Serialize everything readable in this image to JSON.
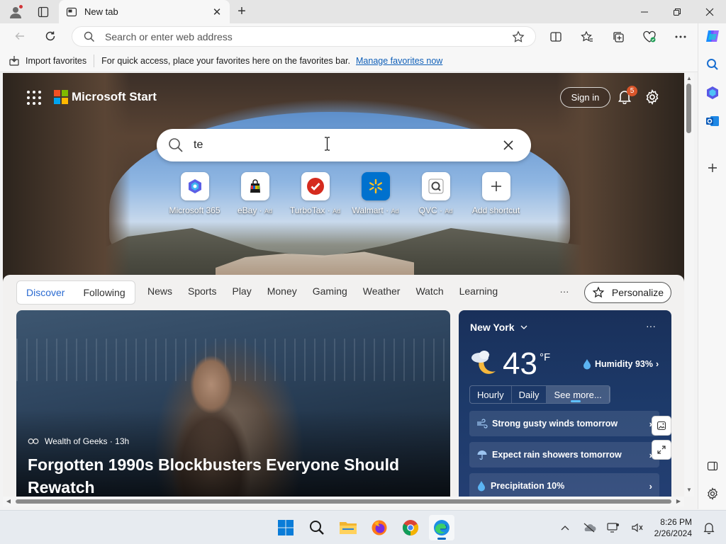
{
  "browser": {
    "tab_title": "New tab",
    "address_placeholder": "Search or enter web address"
  },
  "favorites_bar": {
    "import_label": "Import favorites",
    "hint_text": "For quick access, place your favorites here on the favorites bar.",
    "manage_link": "Manage favorites now"
  },
  "start": {
    "brand": "Microsoft Start",
    "sign_in": "Sign in",
    "notification_count": "5",
    "search_value": "te",
    "shortcuts": [
      {
        "label": "Microsoft 365",
        "ad": "",
        "icon": "microsoft-365-icon"
      },
      {
        "label": "eBay",
        "ad": "Ad",
        "icon": "ebay-icon"
      },
      {
        "label": "TurboTax",
        "ad": "Ad",
        "icon": "turbotax-icon"
      },
      {
        "label": "Walmart",
        "ad": "Ad",
        "icon": "walmart-icon"
      },
      {
        "label": "QVC",
        "ad": "Ad",
        "icon": "qvc-icon"
      },
      {
        "label": "Add shortcut",
        "ad": "",
        "icon": "plus-icon"
      }
    ]
  },
  "feed": {
    "primary_tabs": [
      "Discover",
      "Following"
    ],
    "active_tab": "Discover",
    "categories": [
      "News",
      "Sports",
      "Play",
      "Money",
      "Gaming",
      "Weather",
      "Watch",
      "Learning"
    ],
    "more": "···",
    "personalize": "Personalize"
  },
  "article": {
    "source": "Wealth of Geeks · 13h",
    "title": "Forgotten 1990s Blockbusters Everyone Should Rewatch"
  },
  "weather": {
    "city": "New York",
    "more": "···",
    "temperature": "43",
    "unit": "°F",
    "humidity": "Humidity 93%",
    "tabs": [
      "Hourly",
      "Daily",
      "See more..."
    ],
    "selected_tab": "See more...",
    "alerts": [
      {
        "text": "Strong gusty winds tomorrow",
        "icon": "wind-icon"
      },
      {
        "text": "Expect rain showers tomorrow",
        "icon": "umbrella-icon"
      },
      {
        "text": "Precipitation 10%",
        "icon": "droplet-icon"
      }
    ]
  },
  "taskbar": {
    "apps": [
      "windows-start-icon",
      "search-icon",
      "file-explorer-icon",
      "firefox-icon",
      "chrome-icon",
      "edge-icon"
    ],
    "active_app": "edge-icon",
    "time": "8:26 PM",
    "date": "2/26/2024"
  },
  "colors": {
    "accent": "#2b6bd1",
    "link": "#0f5fb8",
    "notification_badge": "#d8552a",
    "weather_card": "#1d3a6a"
  }
}
